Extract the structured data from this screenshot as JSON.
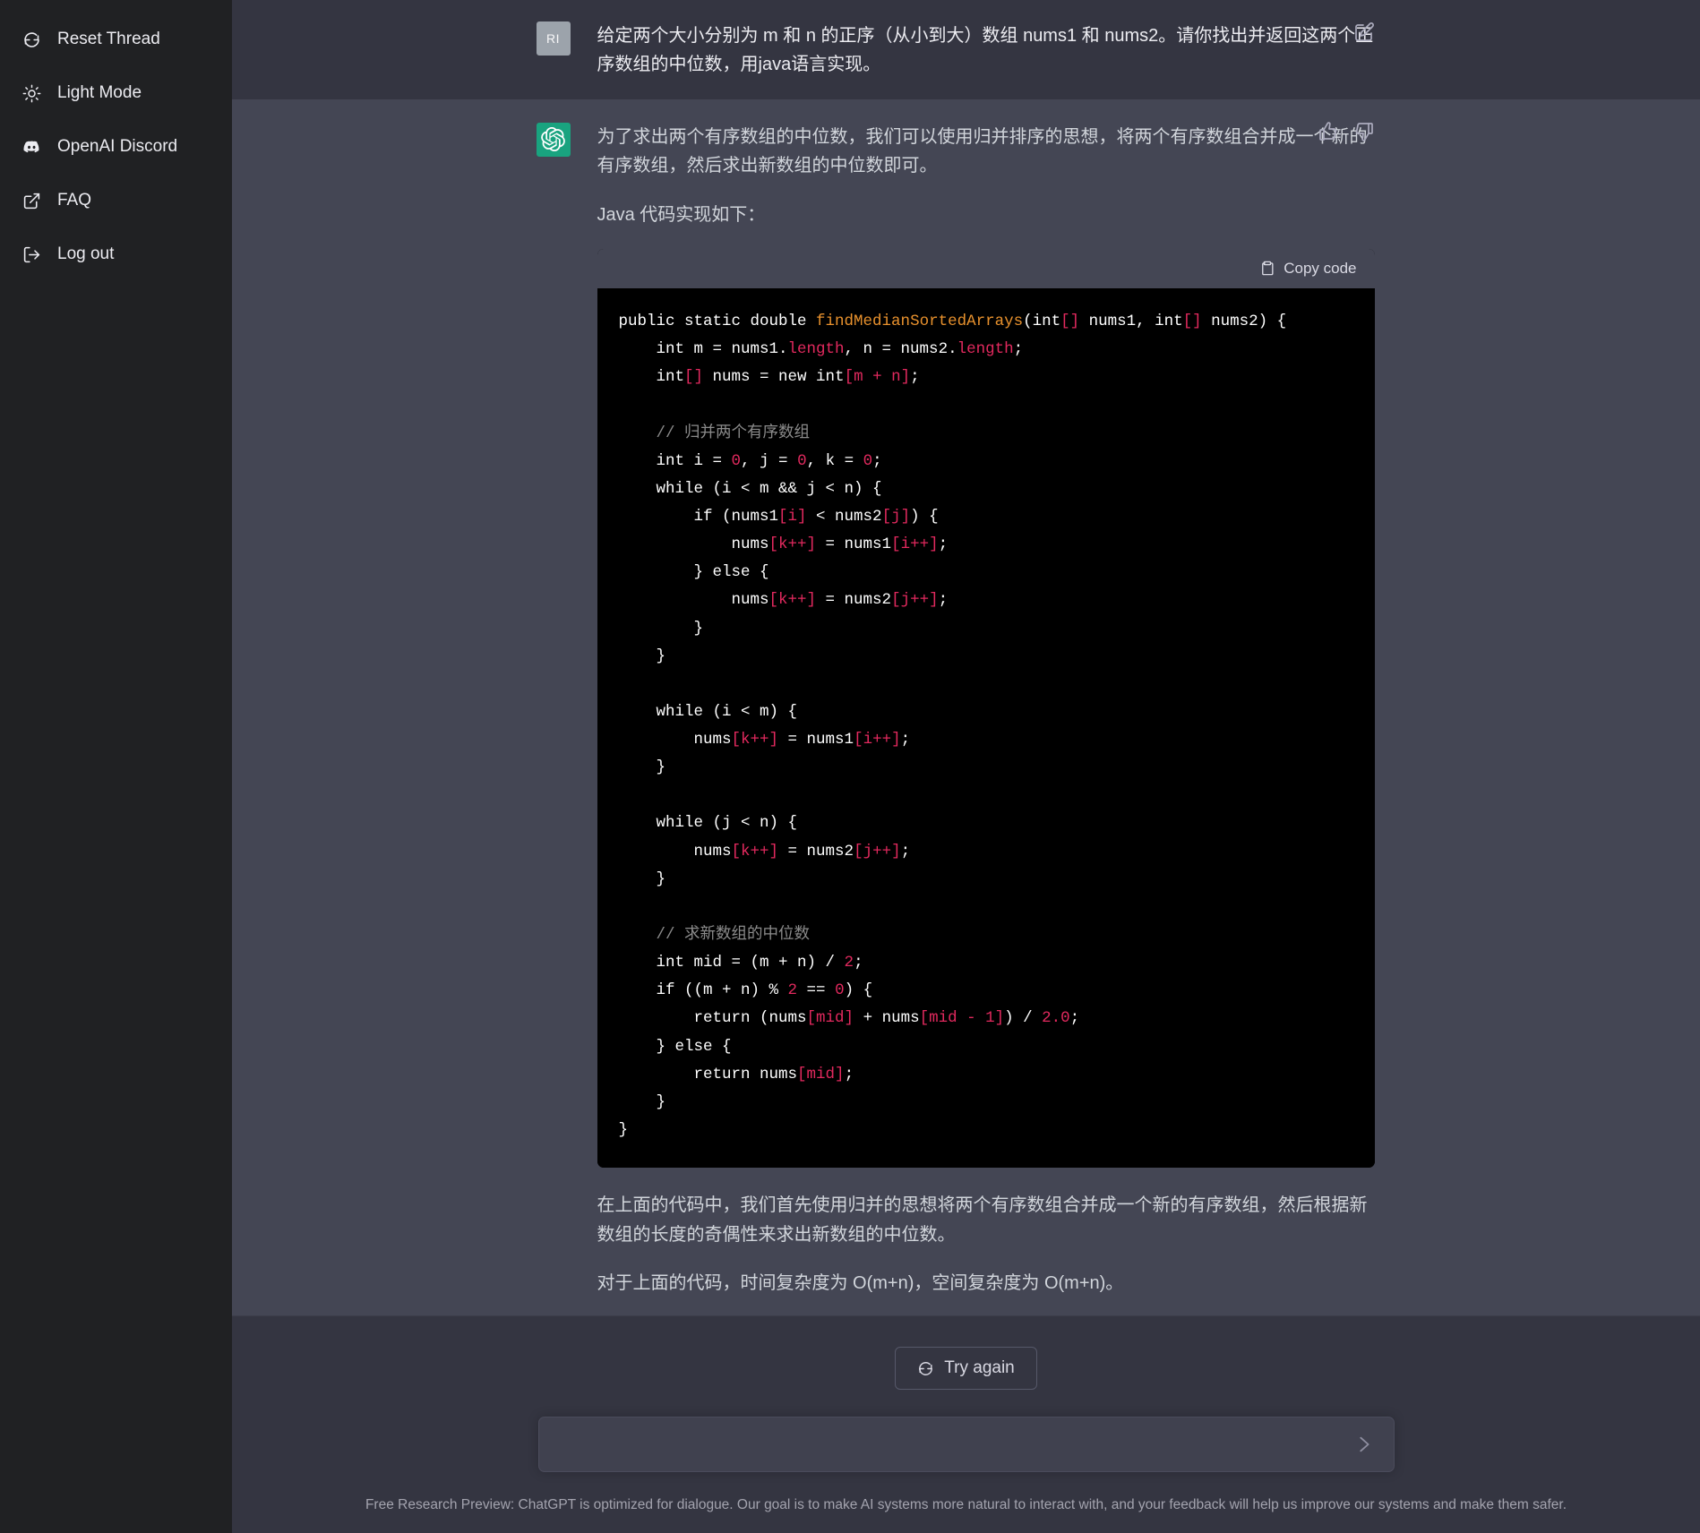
{
  "sidebar": {
    "items": [
      {
        "label": "Reset Thread",
        "icon": "refresh-icon",
        "name": "reset-thread"
      },
      {
        "label": "Light Mode",
        "icon": "sun-icon",
        "name": "light-mode"
      },
      {
        "label": "OpenAI Discord",
        "icon": "discord-icon",
        "name": "openai-discord"
      },
      {
        "label": "FAQ",
        "icon": "external-link-icon",
        "name": "faq"
      },
      {
        "label": "Log out",
        "icon": "logout-icon",
        "name": "log-out"
      }
    ]
  },
  "conversation": {
    "user_message": {
      "avatar_initials": "RI",
      "text": "给定两个大小分别为 m 和 n 的正序（从小到大）数组 nums1 和 nums2。请你找出并返回这两个正序数组的中位数，用java语言实现。",
      "edit_tooltip": "Edit message"
    },
    "assistant_message": {
      "paragraph_1": "为了求出两个有序数组的中位数，我们可以使用归并排序的思想，将两个有序数组合并成一个新的有序数组，然后求出新数组的中位数即可。",
      "paragraph_2": "Java 代码实现如下：",
      "paragraph_3": "在上面的代码中，我们首先使用归并的思想将两个有序数组合并成一个新的有序数组，然后根据新数组的长度的奇偶性来求出新数组的中位数。",
      "paragraph_4": "对于上面的代码，时间复杂度为 O(m+n)，空间复杂度为 O(m+n)。",
      "thumbs_up": "Good response",
      "thumbs_down": "Bad response"
    },
    "code_block": {
      "copy_label": "Copy code",
      "language": "java",
      "lines": [
        "public static double findMedianSortedArrays(int[] nums1, int[] nums2) {",
        "    int m = nums1.length, n = nums2.length;",
        "    int[] nums = new int[m + n];",
        "",
        "    // 归并两个有序数组",
        "    int i = 0, j = 0, k = 0;",
        "    while (i < m && j < n) {",
        "        if (nums1[i] < nums2[j]) {",
        "            nums[k++] = nums1[i++];",
        "        } else {",
        "            nums[k++] = nums2[j++];",
        "        }",
        "    }",
        "",
        "    while (i < m) {",
        "        nums[k++] = nums1[i++];",
        "    }",
        "",
        "    while (j < n) {",
        "        nums[k++] = nums2[j++];",
        "    }",
        "",
        "    // 求新数组的中位数",
        "    int mid = (m + n) / 2;",
        "    if ((m + n) % 2 == 0) {",
        "        return (nums[mid] + nums[mid - 1]) / 2.0;",
        "    } else {",
        "        return nums[mid];",
        "    }",
        "}"
      ]
    }
  },
  "bottom": {
    "try_again_label": "Try again",
    "composer_value": "",
    "composer_placeholder": "",
    "footer_text": "Free Research Preview: ChatGPT is optimized for dialogue. Our goal is to make AI systems more natural to interact with, and your feedback will help us improve our systems and make them safer."
  },
  "colors": {
    "sidebar_bg": "#202123",
    "user_bg": "#343541",
    "assistant_bg": "#444654",
    "accent_green": "#19a37d",
    "code_bg": "#000000",
    "code_fn": "#e8912d",
    "code_num": "#e2295e"
  }
}
